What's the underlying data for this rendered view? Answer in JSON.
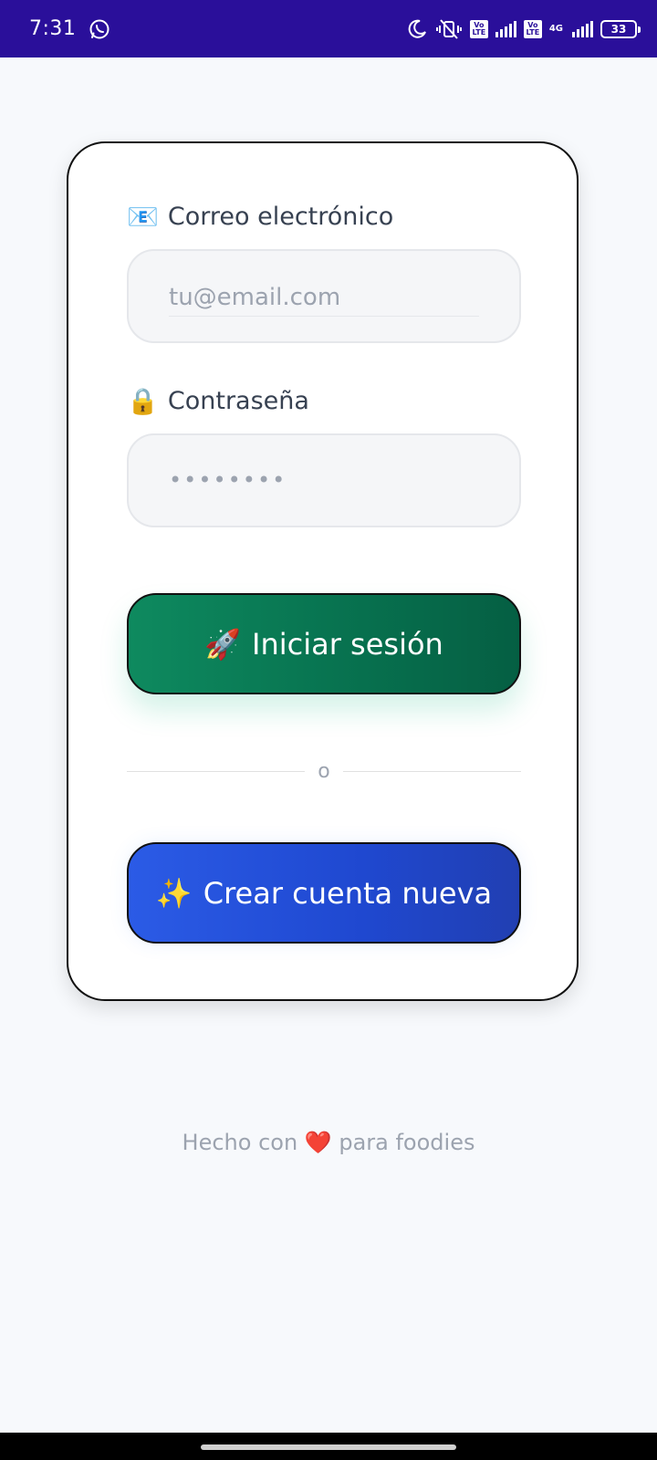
{
  "status_bar": {
    "time": "7:31",
    "whatsapp_icon": "whatsapp-icon",
    "icons": [
      "moon-icon",
      "vibrate-mute-icon",
      "volte-icon",
      "signal-icon",
      "volte-icon",
      "4g-signal-icon"
    ],
    "volte_label": "Vo LTE",
    "network": "4G",
    "battery": "33"
  },
  "form": {
    "email": {
      "emoji": "📧",
      "label": "Correo electrónico",
      "placeholder": "tu@email.com",
      "value": ""
    },
    "password": {
      "emoji": "🔒",
      "label": "Contraseña",
      "masked_value": "••••••••"
    },
    "login_button": {
      "emoji": "🚀",
      "label": "Iniciar sesión"
    },
    "divider_text": "o",
    "create_button": {
      "emoji": "✨",
      "label": "Crear cuenta nueva"
    }
  },
  "footer": {
    "text_before": "Hecho con",
    "heart": "❤️",
    "text_after": "para foodies"
  },
  "colors": {
    "status_bar": "#2a0f9a",
    "login_button": "#0b7d55",
    "create_button": "#2450da",
    "background": "#f7f9fc"
  }
}
